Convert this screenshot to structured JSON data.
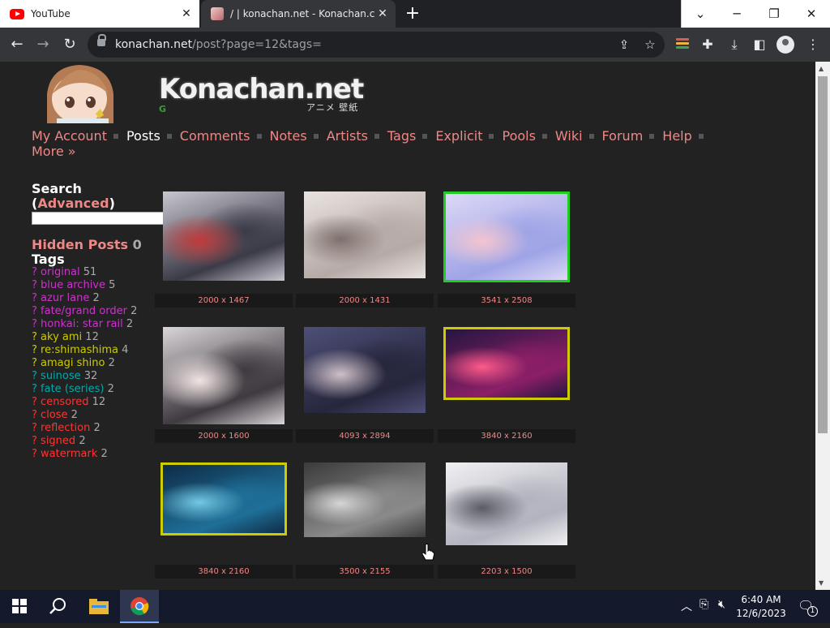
{
  "browser": {
    "tabs": [
      {
        "title": "YouTube",
        "active": false,
        "icon": "youtube-icon"
      },
      {
        "title": "/ | konachan.net - Konachan.com",
        "active": true,
        "icon": "konachan-favicon-icon"
      }
    ],
    "url_host": "konachan.net",
    "url_path": "/post?page=12&tags="
  },
  "site": {
    "logo_text": "Konachan.net",
    "logo_subtitle": "アニメ 壁紙",
    "logo_badge": "G",
    "nav": [
      {
        "label": "My Account",
        "current": false
      },
      {
        "label": "Posts",
        "current": true
      },
      {
        "label": "Comments",
        "current": false
      },
      {
        "label": "Notes",
        "current": false
      },
      {
        "label": "Artists",
        "current": false
      },
      {
        "label": "Tags",
        "current": false
      },
      {
        "label": "Explicit",
        "current": false
      },
      {
        "label": "Pools",
        "current": false
      },
      {
        "label": "Wiki",
        "current": false
      },
      {
        "label": "Forum",
        "current": false
      },
      {
        "label": "Help",
        "current": false
      },
      {
        "label": "More »",
        "current": false
      }
    ]
  },
  "sidebar": {
    "search_label": "Search",
    "advanced_label": "Advanced",
    "search_value": "",
    "hidden_posts_label": "Hidden Posts",
    "hidden_posts_count": "0",
    "tags_heading": "Tags",
    "tags": [
      {
        "name": "original",
        "count": "51",
        "color": "#cc33cc"
      },
      {
        "name": "blue archive",
        "count": "5",
        "color": "#cc33cc"
      },
      {
        "name": "azur lane",
        "count": "2",
        "color": "#cc33cc"
      },
      {
        "name": "fate/grand order",
        "count": "2",
        "color": "#cc33cc"
      },
      {
        "name": "honkai: star rail",
        "count": "2",
        "color": "#cc33cc"
      },
      {
        "name": "aky ami",
        "count": "12",
        "color": "#cccc00"
      },
      {
        "name": "re:shimashima",
        "count": "4",
        "color": "#cccc00"
      },
      {
        "name": "amagi shino",
        "count": "2",
        "color": "#cccc00"
      },
      {
        "name": "suinose",
        "count": "32",
        "color": "#00aaaa"
      },
      {
        "name": "fate (series)",
        "count": "2",
        "color": "#00aaaa"
      },
      {
        "name": "censored",
        "count": "12",
        "color": "#ff3333"
      },
      {
        "name": "close",
        "count": "2",
        "color": "#ff3333"
      },
      {
        "name": "reflection",
        "count": "2",
        "color": "#ff3333"
      },
      {
        "name": "signed",
        "count": "2",
        "color": "#ff3333"
      },
      {
        "name": "watermark",
        "count": "2",
        "color": "#ff3333"
      }
    ]
  },
  "posts": [
    {
      "resolution": "2000 x 1467",
      "border": "none",
      "palette": [
        "#c9c6cf",
        "#3b3b48",
        "#c13a3a"
      ]
    },
    {
      "resolution": "2000 x 1431",
      "border": "none",
      "palette": [
        "#e9e3df",
        "#b6aaa7",
        "#7d6f6c"
      ]
    },
    {
      "resolution": "3541 x 2508",
      "border": "#22cc22",
      "palette": [
        "#dcd8f6",
        "#9fa4e6",
        "#f3c4cf"
      ]
    },
    {
      "resolution": "2000 x 1600",
      "border": "none",
      "palette": [
        "#d9d5d8",
        "#3e3a40",
        "#f2e4e4"
      ]
    },
    {
      "resolution": "4093 x 2894",
      "border": "none",
      "palette": [
        "#4d4f77",
        "#26263c",
        "#cfc0c7"
      ]
    },
    {
      "resolution": "3840 x 2160",
      "border": "#cccc00",
      "palette": [
        "#25163f",
        "#8c1f67",
        "#ff5a8a"
      ]
    },
    {
      "resolution": "3840 x 2160",
      "border": "#cccc00",
      "palette": [
        "#0e2c47",
        "#1f6f98",
        "#72c9e6"
      ]
    },
    {
      "resolution": "3500 x 2155",
      "border": "none",
      "palette": [
        "#3b3b3b",
        "#8a8a8a",
        "#d6d6d6"
      ]
    },
    {
      "resolution": "2203 x 1500",
      "border": "none",
      "palette": [
        "#f1f1f3",
        "#b3b3bf",
        "#5b5b66"
      ]
    }
  ],
  "taskbar": {
    "time": "6:40 AM",
    "date": "12/6/2023",
    "notification_count": "1"
  }
}
